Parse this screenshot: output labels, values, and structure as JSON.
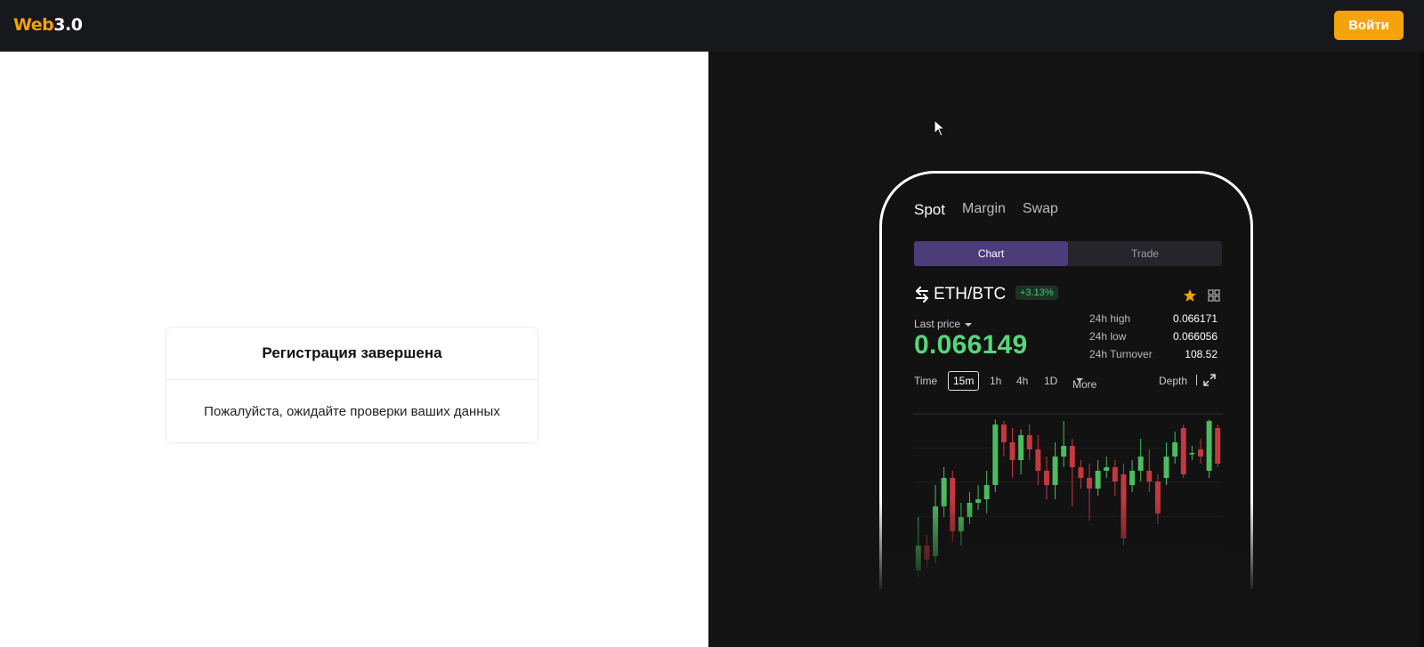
{
  "header": {
    "logo_part1": "Web",
    "logo_part2": "3.0",
    "login_label": "Войти",
    "accent_color": "#f5a30a"
  },
  "card": {
    "title": "Регистрация завершена",
    "message": "Пожалуйста, ожидайте проверки ваших данных"
  },
  "phone": {
    "tabs": [
      "Spot",
      "Margin",
      "Swap"
    ],
    "active_tab": "Spot",
    "segments": [
      "Chart",
      "Trade"
    ],
    "active_segment": "Chart",
    "pair": "ETH/BTC",
    "change": "+3.13%",
    "last_price_label": "Last price",
    "last_price": "0.066149",
    "stats": [
      {
        "label": "24h high",
        "value": "0.066171"
      },
      {
        "label": "24h low",
        "value": "0.066056"
      },
      {
        "label": "24h Turnover",
        "value": "108.52"
      }
    ],
    "time_label": "Time",
    "intervals": [
      "15m",
      "1h",
      "4h",
      "1D"
    ],
    "selected_interval": "15m",
    "more_label": "More",
    "depth_label": "Depth",
    "icons": [
      "swap-arrows-icon",
      "star-icon",
      "grid-icon",
      "expand-icon"
    ],
    "up_color": "#4cbd5f",
    "down_color": "#c5383f"
  },
  "chart_data": {
    "type": "candlestick",
    "candles": [
      {
        "o": 20,
        "c": 55,
        "h": 95,
        "l": 10
      },
      {
        "o": 55,
        "c": 35,
        "h": 70,
        "l": 25
      },
      {
        "o": 40,
        "c": 110,
        "h": 140,
        "l": 30
      },
      {
        "o": 110,
        "c": 150,
        "h": 165,
        "l": 95
      },
      {
        "o": 150,
        "c": 75,
        "h": 160,
        "l": 60
      },
      {
        "o": 75,
        "c": 95,
        "h": 115,
        "l": 55
      },
      {
        "o": 95,
        "c": 115,
        "h": 130,
        "l": 85
      },
      {
        "o": 115,
        "c": 120,
        "h": 140,
        "l": 105
      },
      {
        "o": 120,
        "c": 140,
        "h": 160,
        "l": 100
      },
      {
        "o": 140,
        "c": 225,
        "h": 232,
        "l": 130
      },
      {
        "o": 225,
        "c": 200,
        "h": 230,
        "l": 180
      },
      {
        "o": 200,
        "c": 175,
        "h": 220,
        "l": 150
      },
      {
        "o": 175,
        "c": 210,
        "h": 218,
        "l": 155
      },
      {
        "o": 210,
        "c": 190,
        "h": 225,
        "l": 175
      },
      {
        "o": 190,
        "c": 160,
        "h": 210,
        "l": 140
      },
      {
        "o": 160,
        "c": 140,
        "h": 180,
        "l": 120
      },
      {
        "o": 140,
        "c": 180,
        "h": 200,
        "l": 120
      },
      {
        "o": 180,
        "c": 195,
        "h": 230,
        "l": 165
      },
      {
        "o": 195,
        "c": 165,
        "h": 205,
        "l": 110
      },
      {
        "o": 165,
        "c": 150,
        "h": 175,
        "l": 135
      },
      {
        "o": 150,
        "c": 135,
        "h": 170,
        "l": 90
      },
      {
        "o": 135,
        "c": 160,
        "h": 175,
        "l": 125
      },
      {
        "o": 160,
        "c": 165,
        "h": 180,
        "l": 150
      },
      {
        "o": 165,
        "c": 145,
        "h": 175,
        "l": 125
      },
      {
        "o": 155,
        "c": 65,
        "h": 170,
        "l": 55
      },
      {
        "o": 140,
        "c": 160,
        "h": 175,
        "l": 130
      },
      {
        "o": 160,
        "c": 180,
        "h": 205,
        "l": 145
      },
      {
        "o": 160,
        "c": 145,
        "h": 190,
        "l": 130
      },
      {
        "o": 145,
        "c": 100,
        "h": 155,
        "l": 85
      },
      {
        "o": 150,
        "c": 180,
        "h": 200,
        "l": 140
      },
      {
        "o": 180,
        "c": 200,
        "h": 215,
        "l": 170
      },
      {
        "o": 220,
        "c": 155,
        "h": 225,
        "l": 150
      },
      {
        "o": 185,
        "c": 185,
        "h": 195,
        "l": 175
      },
      {
        "o": 190,
        "c": 180,
        "h": 205,
        "l": 170
      },
      {
        "o": 160,
        "c": 230,
        "h": 232,
        "l": 150
      },
      {
        "o": 220,
        "c": 170,
        "h": 225,
        "l": 165
      }
    ],
    "ylim": [
      0,
      240
    ]
  }
}
